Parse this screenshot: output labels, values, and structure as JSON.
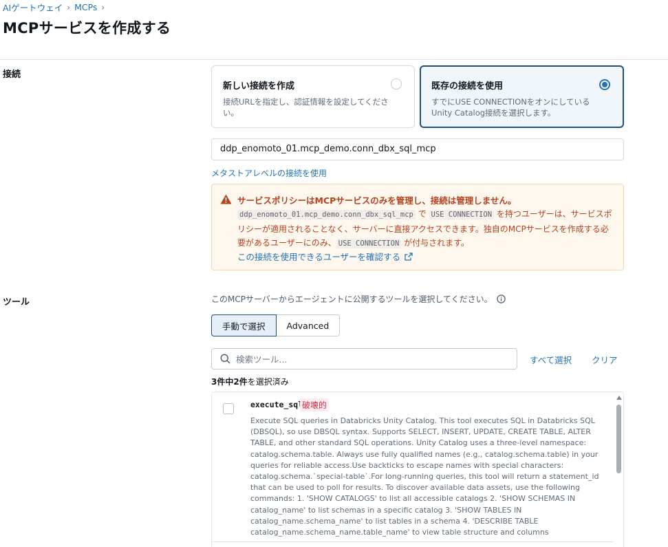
{
  "breadcrumb": {
    "items": [
      "AIゲートウェイ",
      "MCPs"
    ],
    "separator": "›"
  },
  "page": {
    "title": "MCPサービスを作成する"
  },
  "connection": {
    "section_label": "接続",
    "new_card": {
      "title": "新しい接続を作成",
      "desc": "接続URLを指定し、認証情報を設定してください。"
    },
    "existing_card": {
      "title": "既存の接続を使用",
      "desc": "すでにUSE CONNECTIONをオンにしているUnity Catalog接続を選択します。"
    },
    "selected": "existing",
    "input_value": "ddp_enomoto_01.mcp_demo.conn_dbx_sql_mcp",
    "metastore_link": "メタストアレベルの接続を使用"
  },
  "warning": {
    "title": "サービスポリシーはMCPサービスのみを管理し、接続は管理しません。",
    "code_conn": "ddp_enomoto_01.mcp_demo.conn_dbx_sql_mcp",
    "text_1": " で ",
    "code_use": "USE CONNECTION",
    "text_2": " を持つユーザーは、サービスポリシーが適用されることなく、サーバーに直接アクセスできます。独自のMCPサービスを作成する必要があるユーザーにのみ、",
    "code_use_2": "USE CONNECTION",
    "text_3": " が付与されます。",
    "link": "この接続を使用できるユーザーを確認する",
    "color": "#b3421f"
  },
  "tools": {
    "section_label": "ツール",
    "description": "このMCPサーバーからエージェントに公開するツールを選択してください。",
    "segments": [
      "手動で選択",
      "Advanced"
    ],
    "active_segment": "手動で選択",
    "search_placeholder": "検索ツール...",
    "select_all": "すべて選択",
    "clear": "クリア",
    "count_total": "3件中",
    "count_selected": "2件",
    "count_suffix": "を選択済み",
    "items": [
      {
        "name": "execute_sql",
        "tag": "破壊的",
        "checked": false,
        "description": "Execute SQL queries in Databricks Unity Catalog. This tool executes SQL in Databricks SQL (DBSQL), so use DBSQL syntax. Supports SELECT, INSERT, UPDATE, CREATE TABLE, ALTER TABLE, and other standard SQL operations. Unity Catalog uses a three-level namespace: catalog.schema.table. Always use fully qualified names (e.g., catalog.schema.table) in your queries for reliable access.Use backticks to escape names with special characters: catalog.schema.`special-table`.For long-running queries, this tool will return a statement_id that can be used to poll for results. To discover available data assets, use the following commands: 1. 'SHOW CATALOGS' to list all accessible catalogs 2. 'SHOW SCHEMAS IN catalog_name' to list schemas in a specific catalog 3. 'SHOW TABLES IN catalog_name.schema_name' to list tables in a schema 4. 'DESCRIBE TABLE catalog_name.schema_name.table_name' to view table structure and columns"
      }
    ]
  },
  "colors": {
    "accent": "#2272b4",
    "selected_border": "#1f4e79",
    "destructive": "#c82d4c"
  }
}
